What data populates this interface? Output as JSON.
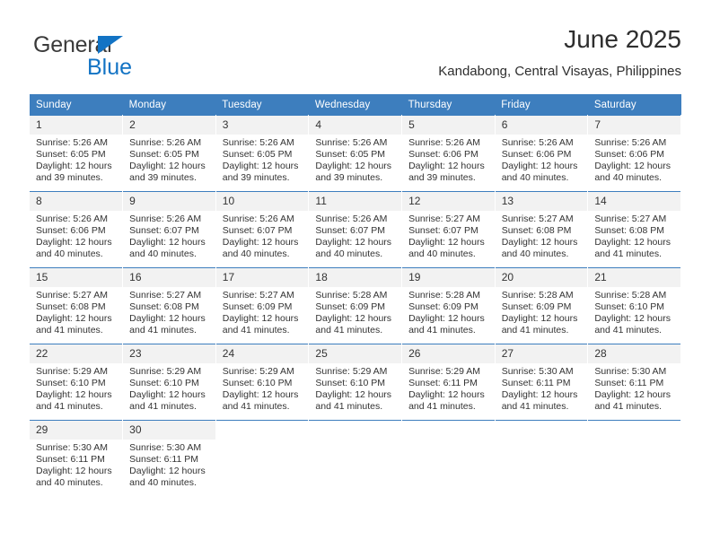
{
  "brand": {
    "name_top": "General",
    "name_bottom": "Blue",
    "accent_color": "#1273c4"
  },
  "header": {
    "title": "June 2025",
    "location": "Kandabong, Central Visayas, Philippines"
  },
  "theme": {
    "header_row_bg": "#3d7ebe",
    "header_row_text": "#ffffff",
    "daynum_bg": "#f2f2f2",
    "cell_bg": "#ffffff",
    "text": "#333333"
  },
  "weekday_headers": [
    "Sunday",
    "Monday",
    "Tuesday",
    "Wednesday",
    "Thursday",
    "Friday",
    "Saturday"
  ],
  "weeks": [
    [
      {
        "day": "1",
        "sunrise": "Sunrise: 5:26 AM",
        "sunset": "Sunset: 6:05 PM",
        "daylight1": "Daylight: 12 hours",
        "daylight2": "and 39 minutes."
      },
      {
        "day": "2",
        "sunrise": "Sunrise: 5:26 AM",
        "sunset": "Sunset: 6:05 PM",
        "daylight1": "Daylight: 12 hours",
        "daylight2": "and 39 minutes."
      },
      {
        "day": "3",
        "sunrise": "Sunrise: 5:26 AM",
        "sunset": "Sunset: 6:05 PM",
        "daylight1": "Daylight: 12 hours",
        "daylight2": "and 39 minutes."
      },
      {
        "day": "4",
        "sunrise": "Sunrise: 5:26 AM",
        "sunset": "Sunset: 6:05 PM",
        "daylight1": "Daylight: 12 hours",
        "daylight2": "and 39 minutes."
      },
      {
        "day": "5",
        "sunrise": "Sunrise: 5:26 AM",
        "sunset": "Sunset: 6:06 PM",
        "daylight1": "Daylight: 12 hours",
        "daylight2": "and 39 minutes."
      },
      {
        "day": "6",
        "sunrise": "Sunrise: 5:26 AM",
        "sunset": "Sunset: 6:06 PM",
        "daylight1": "Daylight: 12 hours",
        "daylight2": "and 40 minutes."
      },
      {
        "day": "7",
        "sunrise": "Sunrise: 5:26 AM",
        "sunset": "Sunset: 6:06 PM",
        "daylight1": "Daylight: 12 hours",
        "daylight2": "and 40 minutes."
      }
    ],
    [
      {
        "day": "8",
        "sunrise": "Sunrise: 5:26 AM",
        "sunset": "Sunset: 6:06 PM",
        "daylight1": "Daylight: 12 hours",
        "daylight2": "and 40 minutes."
      },
      {
        "day": "9",
        "sunrise": "Sunrise: 5:26 AM",
        "sunset": "Sunset: 6:07 PM",
        "daylight1": "Daylight: 12 hours",
        "daylight2": "and 40 minutes."
      },
      {
        "day": "10",
        "sunrise": "Sunrise: 5:26 AM",
        "sunset": "Sunset: 6:07 PM",
        "daylight1": "Daylight: 12 hours",
        "daylight2": "and 40 minutes."
      },
      {
        "day": "11",
        "sunrise": "Sunrise: 5:26 AM",
        "sunset": "Sunset: 6:07 PM",
        "daylight1": "Daylight: 12 hours",
        "daylight2": "and 40 minutes."
      },
      {
        "day": "12",
        "sunrise": "Sunrise: 5:27 AM",
        "sunset": "Sunset: 6:07 PM",
        "daylight1": "Daylight: 12 hours",
        "daylight2": "and 40 minutes."
      },
      {
        "day": "13",
        "sunrise": "Sunrise: 5:27 AM",
        "sunset": "Sunset: 6:08 PM",
        "daylight1": "Daylight: 12 hours",
        "daylight2": "and 40 minutes."
      },
      {
        "day": "14",
        "sunrise": "Sunrise: 5:27 AM",
        "sunset": "Sunset: 6:08 PM",
        "daylight1": "Daylight: 12 hours",
        "daylight2": "and 41 minutes."
      }
    ],
    [
      {
        "day": "15",
        "sunrise": "Sunrise: 5:27 AM",
        "sunset": "Sunset: 6:08 PM",
        "daylight1": "Daylight: 12 hours",
        "daylight2": "and 41 minutes."
      },
      {
        "day": "16",
        "sunrise": "Sunrise: 5:27 AM",
        "sunset": "Sunset: 6:08 PM",
        "daylight1": "Daylight: 12 hours",
        "daylight2": "and 41 minutes."
      },
      {
        "day": "17",
        "sunrise": "Sunrise: 5:27 AM",
        "sunset": "Sunset: 6:09 PM",
        "daylight1": "Daylight: 12 hours",
        "daylight2": "and 41 minutes."
      },
      {
        "day": "18",
        "sunrise": "Sunrise: 5:28 AM",
        "sunset": "Sunset: 6:09 PM",
        "daylight1": "Daylight: 12 hours",
        "daylight2": "and 41 minutes."
      },
      {
        "day": "19",
        "sunrise": "Sunrise: 5:28 AM",
        "sunset": "Sunset: 6:09 PM",
        "daylight1": "Daylight: 12 hours",
        "daylight2": "and 41 minutes."
      },
      {
        "day": "20",
        "sunrise": "Sunrise: 5:28 AM",
        "sunset": "Sunset: 6:09 PM",
        "daylight1": "Daylight: 12 hours",
        "daylight2": "and 41 minutes."
      },
      {
        "day": "21",
        "sunrise": "Sunrise: 5:28 AM",
        "sunset": "Sunset: 6:10 PM",
        "daylight1": "Daylight: 12 hours",
        "daylight2": "and 41 minutes."
      }
    ],
    [
      {
        "day": "22",
        "sunrise": "Sunrise: 5:29 AM",
        "sunset": "Sunset: 6:10 PM",
        "daylight1": "Daylight: 12 hours",
        "daylight2": "and 41 minutes."
      },
      {
        "day": "23",
        "sunrise": "Sunrise: 5:29 AM",
        "sunset": "Sunset: 6:10 PM",
        "daylight1": "Daylight: 12 hours",
        "daylight2": "and 41 minutes."
      },
      {
        "day": "24",
        "sunrise": "Sunrise: 5:29 AM",
        "sunset": "Sunset: 6:10 PM",
        "daylight1": "Daylight: 12 hours",
        "daylight2": "and 41 minutes."
      },
      {
        "day": "25",
        "sunrise": "Sunrise: 5:29 AM",
        "sunset": "Sunset: 6:10 PM",
        "daylight1": "Daylight: 12 hours",
        "daylight2": "and 41 minutes."
      },
      {
        "day": "26",
        "sunrise": "Sunrise: 5:29 AM",
        "sunset": "Sunset: 6:11 PM",
        "daylight1": "Daylight: 12 hours",
        "daylight2": "and 41 minutes."
      },
      {
        "day": "27",
        "sunrise": "Sunrise: 5:30 AM",
        "sunset": "Sunset: 6:11 PM",
        "daylight1": "Daylight: 12 hours",
        "daylight2": "and 41 minutes."
      },
      {
        "day": "28",
        "sunrise": "Sunrise: 5:30 AM",
        "sunset": "Sunset: 6:11 PM",
        "daylight1": "Daylight: 12 hours",
        "daylight2": "and 41 minutes."
      }
    ],
    [
      {
        "day": "29",
        "sunrise": "Sunrise: 5:30 AM",
        "sunset": "Sunset: 6:11 PM",
        "daylight1": "Daylight: 12 hours",
        "daylight2": "and 40 minutes."
      },
      {
        "day": "30",
        "sunrise": "Sunrise: 5:30 AM",
        "sunset": "Sunset: 6:11 PM",
        "daylight1": "Daylight: 12 hours",
        "daylight2": "and 40 minutes."
      },
      null,
      null,
      null,
      null,
      null
    ]
  ]
}
